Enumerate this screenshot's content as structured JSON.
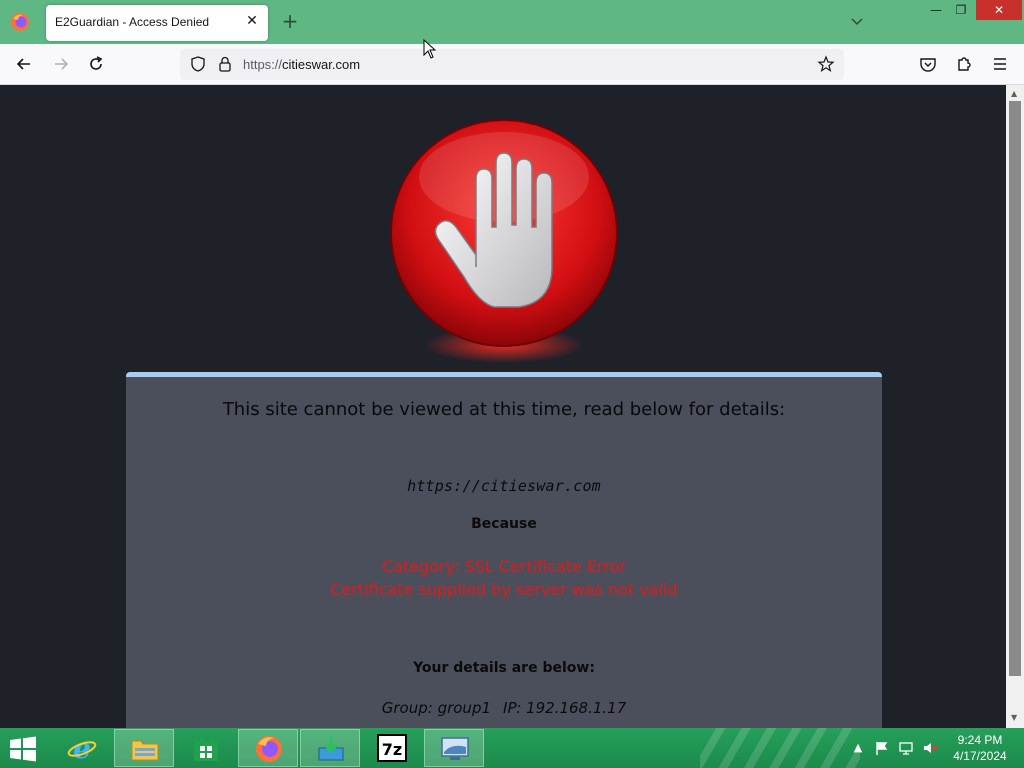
{
  "browser": {
    "tab_title": "E2Guardian - Access Denied",
    "url_scheme": "https://",
    "url_host": "citieswar.com",
    "window_controls": {
      "minimize": "—",
      "restore": "❐",
      "close": "✕"
    },
    "icons": [
      "firefox-icon",
      "tab-close-icon",
      "new-tab-icon",
      "tab-list-chevron-icon",
      "back-icon",
      "forward-icon",
      "reload-icon",
      "shield-icon",
      "lock-icon",
      "bookmark-star-icon",
      "pocket-icon",
      "extensions-icon",
      "menu-icon"
    ]
  },
  "page": {
    "heading": "This site cannot be viewed at this time, read below for details:",
    "blocked_url": "https://citieswar.com",
    "because_label": "Because",
    "reason_line1": "Category: SSL Certificate Error",
    "reason_line2": "Certificate supplied by server was not valid",
    "details_heading": "Your details are below:",
    "group": "Group: group1",
    "ip": "IP: 192.168.1.17",
    "colors": {
      "panel": "#4b4e5b",
      "accent": "#a8cdf4",
      "reason": "#e01b1b",
      "background": "#1f2129"
    }
  },
  "taskbar": {
    "apps": [
      "internet-explorer",
      "file-explorer",
      "store",
      "firefox",
      "installer",
      "7-zip",
      "remote-desktop"
    ],
    "time": "9:24 PM",
    "date": "4/17/2024"
  }
}
